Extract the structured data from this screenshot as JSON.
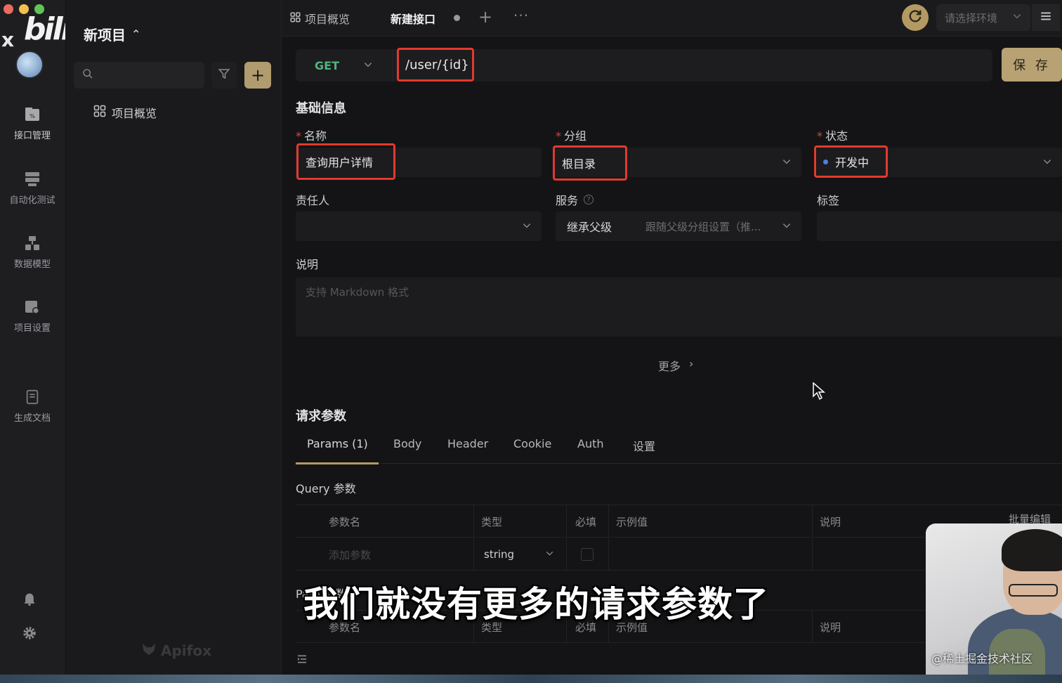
{
  "overlay": {
    "logo_x": "x",
    "logo_text": "bilibili"
  },
  "rail": {
    "items": [
      {
        "label": "接口管理"
      },
      {
        "label": "自动化测试"
      },
      {
        "label": "数据模型"
      },
      {
        "label": "项目设置"
      },
      {
        "label": "生成文档"
      }
    ]
  },
  "tree": {
    "project_name": "新项目",
    "search_placeholder": "",
    "overview_label": "项目概览",
    "brand": "Apifox"
  },
  "topbar": {
    "tab_overview": "项目概览",
    "tab_new": "新建接口",
    "env_placeholder": "请选择环境"
  },
  "request": {
    "method": "GET",
    "url": "/user/{id}",
    "save_label": "保 存"
  },
  "basic": {
    "title": "基础信息",
    "name_label": "名称",
    "name_value": "查询用户详情",
    "group_label": "分组",
    "group_value": "根目录",
    "status_label": "状态",
    "status_value": "开发中",
    "owner_label": "责任人",
    "service_label": "服务",
    "service_value": "继承父级",
    "service_hint": "跟随父级分组设置（推...",
    "tags_label": "标签",
    "desc_label": "说明",
    "desc_placeholder": "支持 Markdown 格式",
    "more_label": "更多"
  },
  "params": {
    "title": "请求参数",
    "tabs": [
      "Params (1)",
      "Body",
      "Header",
      "Cookie",
      "Auth",
      "设置"
    ],
    "query_title": "Query 参数",
    "batch_edit": "批量编辑",
    "columns": [
      "参数名",
      "类型",
      "必填",
      "示例值",
      "说明"
    ],
    "add_placeholder": "添加参数",
    "type_value": "string",
    "path_title": "Path 参数"
  },
  "caption": "我们就没有更多的请求参数了",
  "watermark": "@稀土掘金技术社区",
  "colors": {
    "accent": "#b39a63",
    "highlight": "#e23a2d",
    "get": "#4fb57a"
  }
}
